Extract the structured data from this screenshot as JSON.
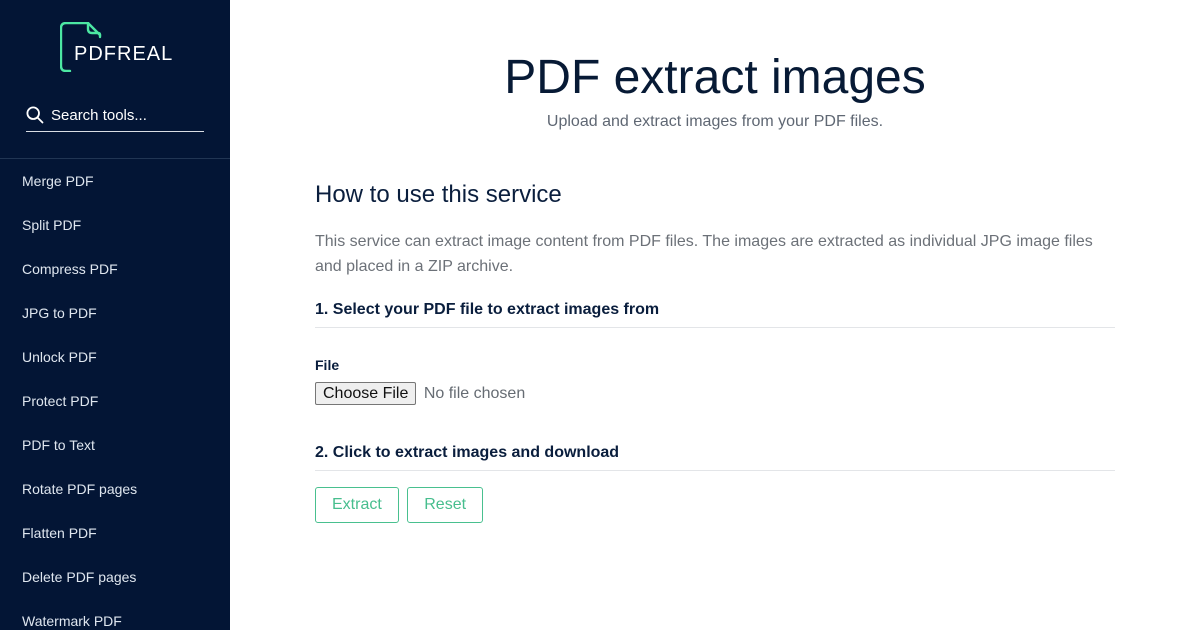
{
  "brand": {
    "name": "PDFREAL",
    "accent_color": "#4ce7a3",
    "sidebar_bg": "#031535"
  },
  "search": {
    "placeholder": "Search tools...",
    "icon": "search-icon"
  },
  "sidebar": {
    "items": [
      {
        "label": "Merge PDF"
      },
      {
        "label": "Split PDF"
      },
      {
        "label": "Compress PDF"
      },
      {
        "label": "JPG to PDF"
      },
      {
        "label": "Unlock PDF"
      },
      {
        "label": "Protect PDF"
      },
      {
        "label": "PDF to Text"
      },
      {
        "label": "Rotate PDF pages"
      },
      {
        "label": "Flatten PDF"
      },
      {
        "label": "Delete PDF pages"
      },
      {
        "label": "Watermark PDF"
      }
    ]
  },
  "main": {
    "title": "PDF extract images",
    "subtitle": "Upload and extract images from your PDF files.",
    "how_title": "How to use this service",
    "description": "This service can extract image content from PDF files. The images are extracted as individual JPG image files and placed in a ZIP archive.",
    "step1": "1. Select your PDF file to extract images from",
    "file_label": "File",
    "choose_file_label": "Choose File",
    "file_status": "No file chosen",
    "step2": "2. Click to extract images and download",
    "extract_label": "Extract",
    "reset_label": "Reset"
  }
}
